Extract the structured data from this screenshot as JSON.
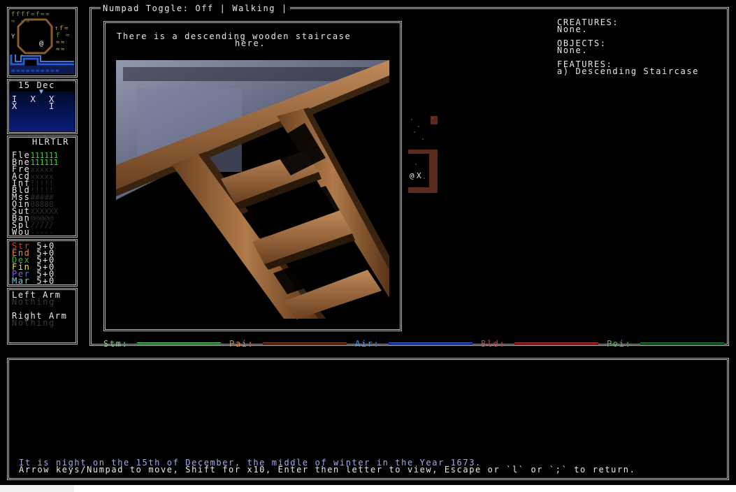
{
  "header": {
    "numpad_toggle": "Numpad Toggle: Off | Walking |"
  },
  "calendar": {
    "date": "15 Dec",
    "row1": "I  X  X",
    "row2": "X     I"
  },
  "health": {
    "title": "HLRTLR",
    "rows": [
      {
        "label": "Fle",
        "value": "111111",
        "color": "#3ddc3d"
      },
      {
        "label": "Bne",
        "value": "111111",
        "color": "#3ddc3d"
      },
      {
        "label": "Fre",
        "value": "xxxxx",
        "color": "#2e2e2e"
      },
      {
        "label": "Acd",
        "value": "xxxxx",
        "color": "#2e2e2e"
      },
      {
        "label": "Inf",
        "value": "!!!!!",
        "color": "#2e2e2e"
      },
      {
        "label": "Bld",
        "value": "!!!!!",
        "color": "#2e2e2e"
      },
      {
        "label": "Mss",
        "value": "#####",
        "color": "#2e2e2e"
      },
      {
        "label": "Oin",
        "value": "88888",
        "color": "#2e2e2e"
      },
      {
        "label": "Sut",
        "value": "XXXXXX",
        "color": "#2e2e2e"
      },
      {
        "label": "Ban",
        "value": "@@@@@",
        "color": "#2e2e2e"
      },
      {
        "label": "Spl",
        "value": "/////",
        "color": "#2e2e2e"
      },
      {
        "label": "Wou",
        "value": "-----",
        "color": "#2e2e2e"
      }
    ]
  },
  "attributes": [
    {
      "label": "Str",
      "value": "5+0",
      "color": "#e83434"
    },
    {
      "label": "End",
      "value": "5+0",
      "color": "#f08a24"
    },
    {
      "label": "Dex",
      "value": "5+0",
      "color": "#36b836"
    },
    {
      "label": "Fin",
      "value": "5+0",
      "color": "#f4e428"
    },
    {
      "label": "Per",
      "value": "5+0",
      "color": "#7c5cff"
    },
    {
      "label": "Mar",
      "value": "5+0",
      "color": "#6ad0f0"
    }
  ],
  "arms": {
    "left_label": "Left Arm",
    "left_value": "Nothing",
    "right_label": "Right Arm",
    "right_value": "Nothing"
  },
  "popup": {
    "line1": "There is a descending wooden staircase",
    "line2": "here.",
    "image_icon": "wooden-ladder-illustration"
  },
  "info": {
    "creatures_label": "CREATURES:",
    "creatures_value": "None.",
    "objects_label": "OBJECTS:",
    "objects_value": "None.",
    "features_label": "FEATURES:",
    "features_value": "a) Descending Staircase"
  },
  "map": {
    "player": "@",
    "cursor": "X"
  },
  "minimap": {
    "player": "@"
  },
  "status_bars": [
    {
      "label": "Stm:",
      "color": "#6ee07a",
      "label_color": "#6ee07a"
    },
    {
      "label": "Pai:",
      "color": "#8a4a2a",
      "label_color": "#f08a24"
    },
    {
      "label": "Air:",
      "color": "#3a6ee0",
      "label_color": "#4a90ff"
    },
    {
      "label": "Bld:",
      "color": "#b8283a",
      "label_color": "#e83434"
    },
    {
      "label": "Poi:",
      "color": "#2a8a4a",
      "label_color": "#3ac26a"
    }
  ],
  "log": {
    "line1": "It is night on the 15th of December, the middle of winter in the Year 1673.",
    "line2": "Arrow keys/Numpad to move, Shift for x10, Enter then letter to view, Escape or `l` or `;` to return."
  }
}
